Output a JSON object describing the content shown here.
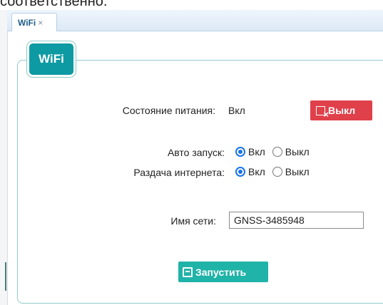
{
  "header": {
    "fragment_text": "соответственно."
  },
  "tabs": [
    {
      "label": "WiFi",
      "close": "×"
    }
  ],
  "panel": {
    "title": "WiFi"
  },
  "power": {
    "label": "Состояние питания:",
    "value": "Вкл",
    "off_button": "Выкл"
  },
  "auto_start": {
    "label": "Авто запуск:",
    "options": [
      {
        "label": "Вкл",
        "checked": true
      },
      {
        "label": "Выкл",
        "checked": false
      }
    ]
  },
  "sharing": {
    "label": "Раздача интернета:",
    "options": [
      {
        "label": "Вкл",
        "checked": true
      },
      {
        "label": "Выкл",
        "checked": false
      }
    ]
  },
  "network": {
    "label": "Имя сети:",
    "value": "GNSS-3485948"
  },
  "start_button": {
    "label": "Запустить"
  },
  "colors": {
    "accent": "#0e9aa2",
    "danger": "#e0404a",
    "start": "#20b3a8"
  }
}
